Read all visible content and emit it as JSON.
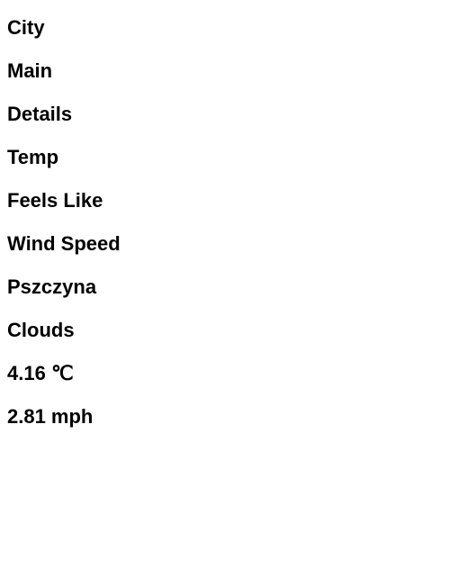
{
  "labels": {
    "city": "City",
    "main": "Main",
    "details": "Details",
    "temp": "Temp",
    "feels_like": "Feels Like",
    "wind_speed": "Wind Speed"
  },
  "values": {
    "city_name": "Pszczyna",
    "main_condition": "Clouds",
    "temperature": "4.16",
    "temperature_unit": "℃",
    "wind_speed": "2.81 mph"
  }
}
